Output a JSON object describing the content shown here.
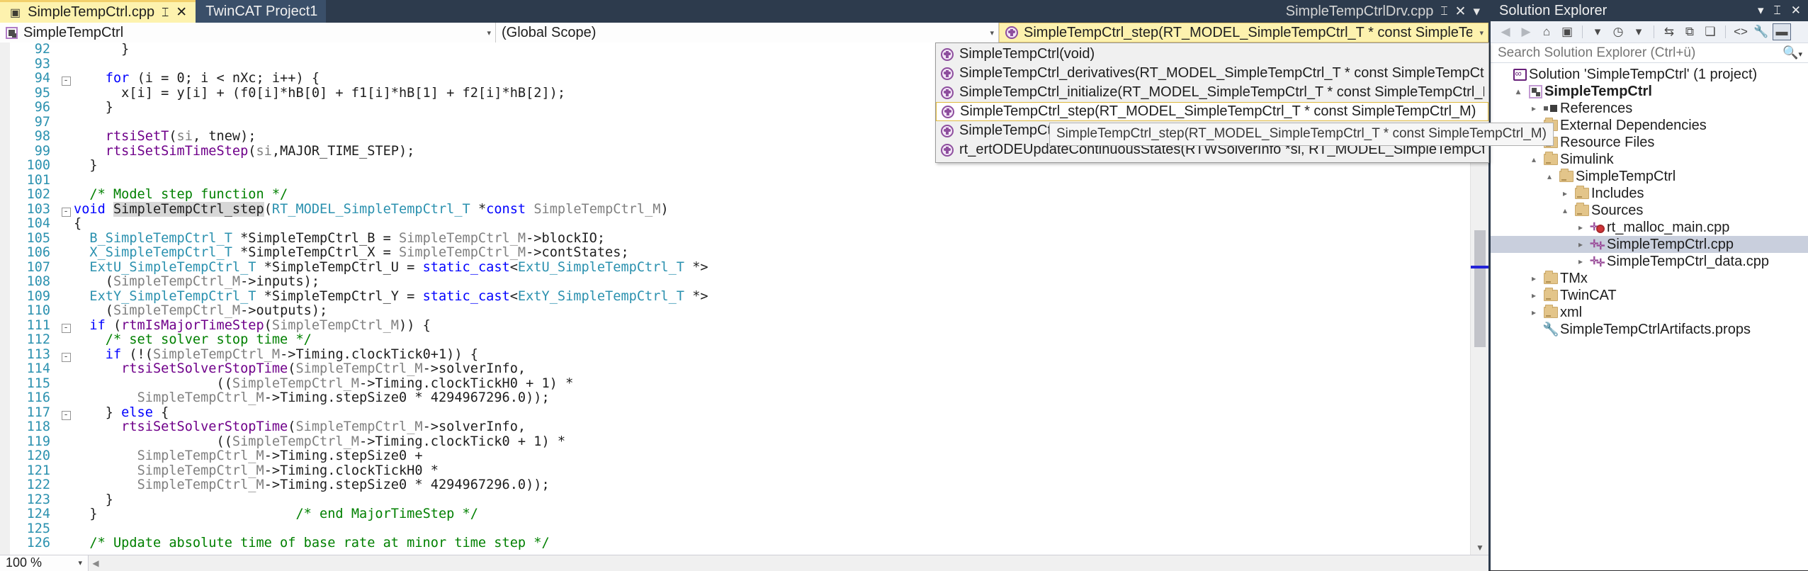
{
  "window": {
    "tabs": [
      {
        "name": "SimpleTempCtrl.cpp",
        "state": "active",
        "pin": "⌶",
        "close": "✕"
      },
      {
        "name": "TwinCAT Project1",
        "state": "inactive"
      },
      {
        "name": "SimpleTempCtrlDrv.cpp",
        "state": "background",
        "pin": "⌶",
        "close": "✕",
        "menu": "▾"
      }
    ]
  },
  "navbar": {
    "type_combo": "SimpleTempCtrl",
    "scope_combo": "(Global Scope)",
    "member_combo": "SimpleTempCtrl_step(RT_MODEL_SimpleTempCtrl_T * const SimpleTempCtrl_M)",
    "arrow": "▾"
  },
  "dropdown": {
    "items": [
      "SimpleTempCtrl(void)",
      "SimpleTempCtrl_derivatives(RT_MODEL_SimpleTempCtrl_T * const SimpleTempCtrl_M)",
      "SimpleTempCtrl_initialize(RT_MODEL_SimpleTempCtrl_T * const SimpleTempCtrl_M)",
      "SimpleTempCtrl_step(RT_MODEL_SimpleTempCtrl_T * const SimpleTempCtrl_M)",
      "SimpleTempCtrl_terminate(RT_MODEL_SimpleTempCtrl_T * const SimpleTempCtrl_M)",
      "rt_ertODEUpdateContinuousStates(RTWSolverInfo *si, RT_MODEL_SimpleTempCtrl_T * const SimpleTempCtrl_M)"
    ],
    "selected_index": 3,
    "tooltip": "SimpleTempCtrl_step(RT_MODEL_SimpleTempCtrl_T * const SimpleTempCtrl_M)"
  },
  "editor": {
    "zoom_level": "100 %",
    "zoom_arrow": "▾",
    "lines": [
      {
        "n": "92",
        "fold": "",
        "indent": 3,
        "tokens": [
          {
            "t": "}",
            "c": ""
          }
        ]
      },
      {
        "n": "93",
        "fold": "",
        "indent": 0,
        "tokens": []
      },
      {
        "n": "94",
        "fold": "-",
        "indent": 2,
        "tokens": [
          {
            "t": "for",
            "c": "k"
          },
          {
            "t": " (i = 0; i < nXc; i++) {",
            "c": ""
          }
        ]
      },
      {
        "n": "95",
        "fold": "",
        "indent": 3,
        "tokens": [
          {
            "t": "x[i] = y[i] + (f0[i]*hB[0] + f1[i]*hB[1] + f2[i]*hB[2]);",
            "c": ""
          }
        ]
      },
      {
        "n": "96",
        "fold": "",
        "indent": 2,
        "tokens": [
          {
            "t": "}",
            "c": ""
          }
        ]
      },
      {
        "n": "97",
        "fold": "",
        "indent": 0,
        "tokens": []
      },
      {
        "n": "98",
        "fold": "",
        "indent": 2,
        "tokens": [
          {
            "t": "rtsiSetT",
            "c": "p"
          },
          {
            "t": "(",
            "c": ""
          },
          {
            "t": "si",
            "c": "g"
          },
          {
            "t": ", tnew);",
            "c": ""
          }
        ]
      },
      {
        "n": "99",
        "fold": "",
        "indent": 2,
        "tokens": [
          {
            "t": "rtsiSetSimTimeStep",
            "c": "p"
          },
          {
            "t": "(",
            "c": ""
          },
          {
            "t": "si",
            "c": "g"
          },
          {
            "t": ",MAJOR_TIME_STEP);",
            "c": ""
          }
        ]
      },
      {
        "n": "100",
        "fold": "",
        "indent": 1,
        "tokens": [
          {
            "t": "}",
            "c": ""
          }
        ]
      },
      {
        "n": "101",
        "fold": "",
        "indent": 0,
        "tokens": []
      },
      {
        "n": "102",
        "fold": "",
        "indent": 1,
        "tokens": [
          {
            "t": "/* Model step function */",
            "c": "c"
          }
        ]
      },
      {
        "n": "103",
        "fold": "-",
        "indent": 0,
        "tokens": [
          {
            "t": "void",
            "c": "k"
          },
          {
            "t": " ",
            "c": ""
          },
          {
            "t": "SimpleTempCtrl_step",
            "c": "hl"
          },
          {
            "t": "(",
            "c": ""
          },
          {
            "t": "RT_MODEL_SimpleTempCtrl_T",
            "c": "t"
          },
          {
            "t": " *",
            "c": ""
          },
          {
            "t": "const",
            "c": "k"
          },
          {
            "t": " ",
            "c": ""
          },
          {
            "t": "SimpleTempCtrl_M",
            "c": "g"
          },
          {
            "t": ")",
            "c": ""
          }
        ]
      },
      {
        "n": "104",
        "fold": "",
        "indent": 0,
        "tokens": [
          {
            "t": "{",
            "c": ""
          }
        ]
      },
      {
        "n": "105",
        "fold": "",
        "indent": 1,
        "tokens": [
          {
            "t": "B_SimpleTempCtrl_T",
            "c": "t"
          },
          {
            "t": " *SimpleTempCtrl_B = ",
            "c": ""
          },
          {
            "t": "SimpleTempCtrl_M",
            "c": "g"
          },
          {
            "t": "->blockIO;",
            "c": ""
          }
        ]
      },
      {
        "n": "106",
        "fold": "",
        "indent": 1,
        "tokens": [
          {
            "t": "X_SimpleTempCtrl_T",
            "c": "t"
          },
          {
            "t": " *SimpleTempCtrl_X = ",
            "c": ""
          },
          {
            "t": "SimpleTempCtrl_M",
            "c": "g"
          },
          {
            "t": "->contStates;",
            "c": ""
          }
        ]
      },
      {
        "n": "107",
        "fold": "",
        "indent": 1,
        "tokens": [
          {
            "t": "ExtU_SimpleTempCtrl_T",
            "c": "t"
          },
          {
            "t": " *SimpleTempCtrl_U = ",
            "c": ""
          },
          {
            "t": "static_cast",
            "c": "k"
          },
          {
            "t": "<",
            "c": ""
          },
          {
            "t": "ExtU_SimpleTempCtrl_T",
            "c": "t"
          },
          {
            "t": " *>",
            "c": ""
          }
        ]
      },
      {
        "n": "108",
        "fold": "",
        "indent": 2,
        "tokens": [
          {
            "t": "(",
            "c": ""
          },
          {
            "t": "SimpleTempCtrl_M",
            "c": "g"
          },
          {
            "t": "->inputs);",
            "c": ""
          }
        ]
      },
      {
        "n": "109",
        "fold": "",
        "indent": 1,
        "tokens": [
          {
            "t": "ExtY_SimpleTempCtrl_T",
            "c": "t"
          },
          {
            "t": " *SimpleTempCtrl_Y = ",
            "c": ""
          },
          {
            "t": "static_cast",
            "c": "k"
          },
          {
            "t": "<",
            "c": ""
          },
          {
            "t": "ExtY_SimpleTempCtrl_T",
            "c": "t"
          },
          {
            "t": " *>",
            "c": ""
          }
        ]
      },
      {
        "n": "110",
        "fold": "",
        "indent": 2,
        "tokens": [
          {
            "t": "(",
            "c": ""
          },
          {
            "t": "SimpleTempCtrl_M",
            "c": "g"
          },
          {
            "t": "->outputs);",
            "c": ""
          }
        ]
      },
      {
        "n": "111",
        "fold": "-",
        "indent": 1,
        "tokens": [
          {
            "t": "if",
            "c": "k"
          },
          {
            "t": " (",
            "c": ""
          },
          {
            "t": "rtmIsMajorTimeStep",
            "c": "p"
          },
          {
            "t": "(",
            "c": ""
          },
          {
            "t": "SimpleTempCtrl_M",
            "c": "g"
          },
          {
            "t": ")) {",
            "c": ""
          }
        ]
      },
      {
        "n": "112",
        "fold": "",
        "indent": 2,
        "tokens": [
          {
            "t": "/* set solver stop time */",
            "c": "c"
          }
        ]
      },
      {
        "n": "113",
        "fold": "-",
        "indent": 2,
        "tokens": [
          {
            "t": "if",
            "c": "k"
          },
          {
            "t": " (!(",
            "c": ""
          },
          {
            "t": "SimpleTempCtrl_M",
            "c": "g"
          },
          {
            "t": "->Timing.clockTick0+1)) {",
            "c": ""
          }
        ]
      },
      {
        "n": "114",
        "fold": "",
        "indent": 3,
        "tokens": [
          {
            "t": "rtsiSetSolverStopTime",
            "c": "p"
          },
          {
            "t": "(",
            "c": ""
          },
          {
            "t": "SimpleTempCtrl_M",
            "c": "g"
          },
          {
            "t": "->solverInfo,",
            "c": ""
          }
        ]
      },
      {
        "n": "115",
        "fold": "",
        "indent": 9,
        "tokens": [
          {
            "t": "((",
            "c": ""
          },
          {
            "t": "SimpleTempCtrl_M",
            "c": "g"
          },
          {
            "t": "->Timing.clockTickH0 + 1) *",
            "c": ""
          }
        ]
      },
      {
        "n": "116",
        "fold": "",
        "indent": 4,
        "tokens": [
          {
            "t": "SimpleTempCtrl_M",
            "c": "g"
          },
          {
            "t": "->Timing.stepSize0 * 4294967296.0));",
            "c": ""
          }
        ]
      },
      {
        "n": "117",
        "fold": "-",
        "indent": 2,
        "tokens": [
          {
            "t": "} ",
            "c": ""
          },
          {
            "t": "else",
            "c": "k"
          },
          {
            "t": " {",
            "c": ""
          }
        ]
      },
      {
        "n": "118",
        "fold": "",
        "indent": 3,
        "tokens": [
          {
            "t": "rtsiSetSolverStopTime",
            "c": "p"
          },
          {
            "t": "(",
            "c": ""
          },
          {
            "t": "SimpleTempCtrl_M",
            "c": "g"
          },
          {
            "t": "->solverInfo,",
            "c": ""
          }
        ]
      },
      {
        "n": "119",
        "fold": "",
        "indent": 9,
        "tokens": [
          {
            "t": "((",
            "c": ""
          },
          {
            "t": "SimpleTempCtrl_M",
            "c": "g"
          },
          {
            "t": "->Timing.clockTick0 + 1) *",
            "c": ""
          }
        ]
      },
      {
        "n": "120",
        "fold": "",
        "indent": 4,
        "tokens": [
          {
            "t": "SimpleTempCtrl_M",
            "c": "g"
          },
          {
            "t": "->Timing.stepSize0 +",
            "c": ""
          }
        ]
      },
      {
        "n": "121",
        "fold": "",
        "indent": 4,
        "tokens": [
          {
            "t": "SimpleTempCtrl_M",
            "c": "g"
          },
          {
            "t": "->Timing.clockTickH0 *",
            "c": ""
          }
        ]
      },
      {
        "n": "122",
        "fold": "",
        "indent": 4,
        "tokens": [
          {
            "t": "SimpleTempCtrl_M",
            "c": "g"
          },
          {
            "t": "->Timing.stepSize0 * 4294967296.0));",
            "c": ""
          }
        ]
      },
      {
        "n": "123",
        "fold": "",
        "indent": 2,
        "tokens": [
          {
            "t": "}",
            "c": ""
          }
        ]
      },
      {
        "n": "124",
        "fold": "",
        "indent": 1,
        "tokens": [
          {
            "t": "}                         ",
            "c": ""
          },
          {
            "t": "/* end MajorTimeStep */",
            "c": "c"
          }
        ]
      },
      {
        "n": "125",
        "fold": "",
        "indent": 0,
        "tokens": []
      },
      {
        "n": "126",
        "fold": "",
        "indent": 1,
        "tokens": [
          {
            "t": "/* Update absolute time of base rate at minor time step */",
            "c": "c"
          }
        ]
      }
    ]
  },
  "solution_explorer": {
    "title": "Solution Explorer",
    "title_buttons": {
      "dropdown": "▾",
      "pin": "⌶",
      "close": "✕"
    },
    "toolbar": [
      {
        "name": "back",
        "glyph": "◀",
        "state": "disabled"
      },
      {
        "name": "forward",
        "glyph": "▶",
        "state": "disabled"
      },
      {
        "name": "home",
        "glyph": "⌂",
        "state": "enabled"
      },
      {
        "name": "show-all-files",
        "glyph": "▣",
        "state": "enabled"
      },
      {
        "name": "show-all-files-dropdown",
        "glyph": "▾",
        "state": "enabled"
      },
      {
        "name": "pending-changes",
        "glyph": "◷",
        "state": "enabled"
      },
      {
        "name": "pending-changes-dropdown",
        "glyph": "▾",
        "state": "enabled"
      },
      {
        "name": "sync-with-active-document",
        "glyph": "⇆",
        "state": "enabled"
      },
      {
        "name": "refresh",
        "glyph": "⧉",
        "state": "enabled"
      },
      {
        "name": "collapse-all",
        "glyph": "❏",
        "state": "enabled"
      },
      {
        "name": "view-code",
        "glyph": "<>",
        "state": "enabled"
      },
      {
        "name": "properties",
        "glyph": "🔧",
        "state": "enabled"
      },
      {
        "name": "preview-selected-items",
        "glyph": "▬",
        "state": "active"
      }
    ],
    "search_placeholder": "Search Solution Explorer (Ctrl+ü)",
    "search_icon": "search-icon",
    "tree": [
      {
        "label": "Solution 'SimpleTempCtrl' (1 project)",
        "depth": 0,
        "exp": "",
        "icon": "solution",
        "bold": false,
        "sel": false
      },
      {
        "label": "SimpleTempCtrl",
        "depth": 1,
        "exp": "▴",
        "icon": "project",
        "bold": true,
        "sel": false
      },
      {
        "label": "References",
        "depth": 2,
        "exp": "▸",
        "icon": "refs",
        "bold": false,
        "sel": false
      },
      {
        "label": "External Dependencies",
        "depth": 2,
        "exp": "▸",
        "icon": "folder-ext",
        "bold": false,
        "sel": false
      },
      {
        "label": "Resource Files",
        "depth": 2,
        "exp": "▸",
        "icon": "folder",
        "bold": false,
        "sel": false
      },
      {
        "label": "Simulink",
        "depth": 2,
        "exp": "▴",
        "icon": "folder",
        "bold": false,
        "sel": false
      },
      {
        "label": "SimpleTempCtrl",
        "depth": 3,
        "exp": "▴",
        "icon": "folder",
        "bold": false,
        "sel": false
      },
      {
        "label": "Includes",
        "depth": 4,
        "exp": "▸",
        "icon": "folder",
        "bold": false,
        "sel": false
      },
      {
        "label": "Sources",
        "depth": 4,
        "exp": "▴",
        "icon": "folder",
        "bold": false,
        "sel": false
      },
      {
        "label": "rt_malloc_main.cpp",
        "depth": 5,
        "exp": "▸",
        "icon": "cpp-error",
        "bold": false,
        "sel": false
      },
      {
        "label": "SimpleTempCtrl.cpp",
        "depth": 5,
        "exp": "▸",
        "icon": "cpp",
        "bold": false,
        "sel": true
      },
      {
        "label": "SimpleTempCtrl_data.cpp",
        "depth": 5,
        "exp": "▸",
        "icon": "cpp",
        "bold": false,
        "sel": false
      },
      {
        "label": "TMx",
        "depth": 2,
        "exp": "▸",
        "icon": "folder",
        "bold": false,
        "sel": false
      },
      {
        "label": "TwinCAT",
        "depth": 2,
        "exp": "▸",
        "icon": "folder",
        "bold": false,
        "sel": false
      },
      {
        "label": "xml",
        "depth": 2,
        "exp": "▸",
        "icon": "folder",
        "bold": false,
        "sel": false
      },
      {
        "label": "SimpleTempCtrlArtifacts.props",
        "depth": 2,
        "exp": "",
        "icon": "props",
        "bold": false,
        "sel": false
      }
    ]
  },
  "colors": {
    "tab_active_bg": "#fdf2ae",
    "tab_inactive_bg": "#3a4f69",
    "chrome_bg": "#2d3b4d",
    "selection_bg": "#c9cfdd",
    "keyword": "#0000ff",
    "comment": "#008000",
    "type": "#2b91af",
    "macro": "#6f008a",
    "linenum": "#2b91af"
  }
}
